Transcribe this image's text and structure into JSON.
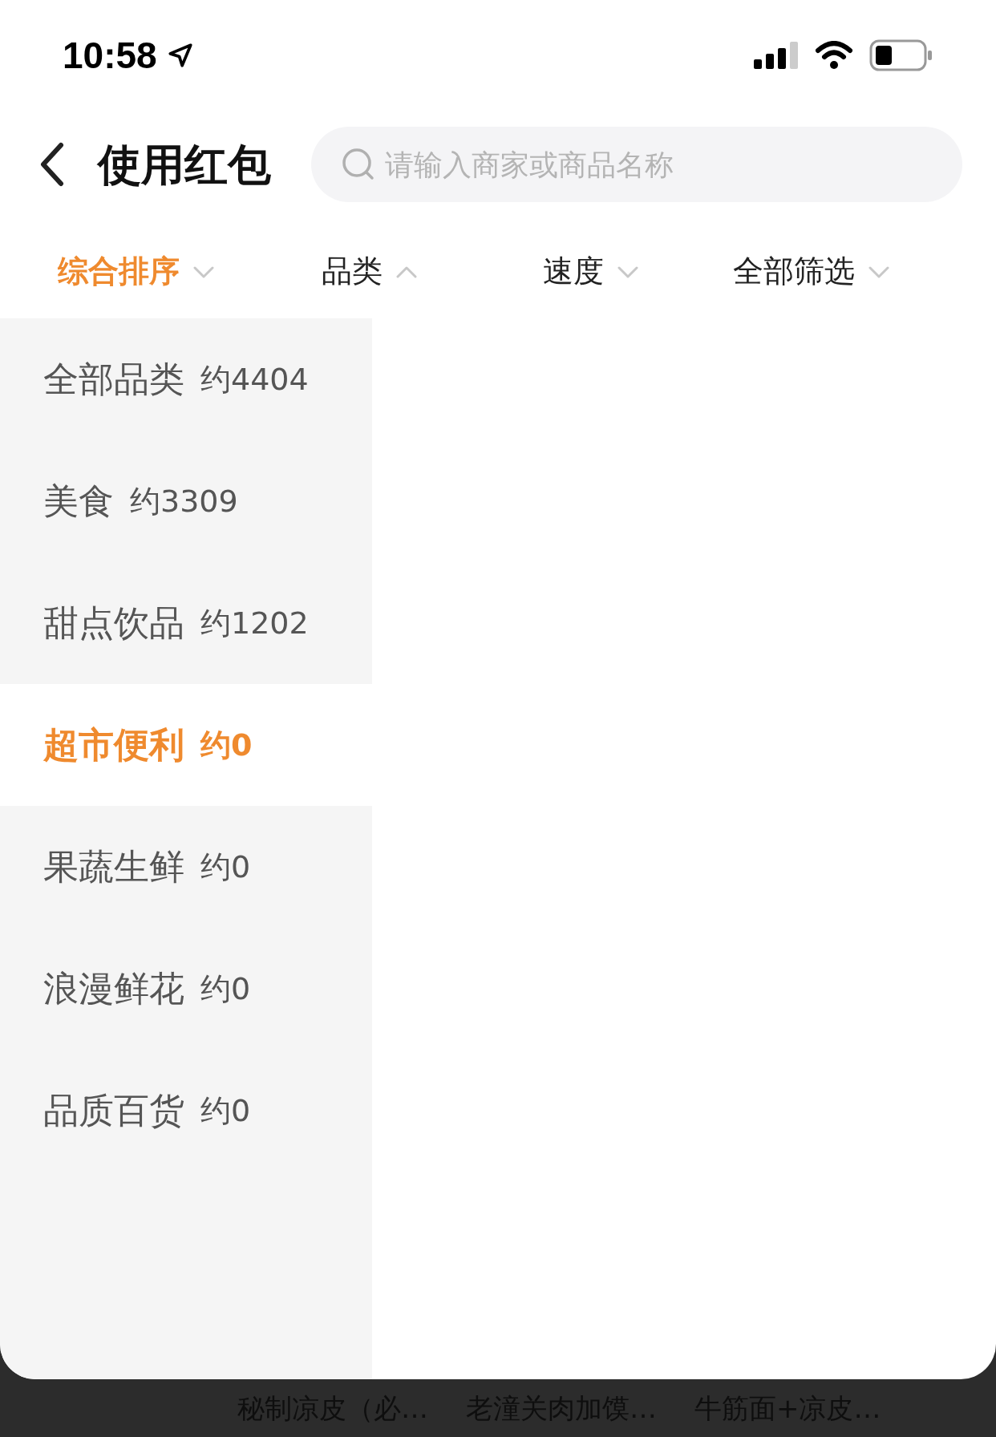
{
  "status_bar": {
    "time": "10:58"
  },
  "header": {
    "title": "使用红包",
    "search": {
      "placeholder": "请输入商家或商品名称"
    }
  },
  "filter_tabs": [
    {
      "label": "综合排序",
      "selected": true,
      "expanded": false
    },
    {
      "label": "品类",
      "selected": false,
      "expanded": true
    },
    {
      "label": "速度",
      "selected": false,
      "expanded": false
    },
    {
      "label": "全部筛选",
      "selected": false,
      "expanded": false
    }
  ],
  "categories": [
    {
      "name": "全部品类",
      "count": "约4404",
      "selected": false
    },
    {
      "name": "美食",
      "count": "约3309",
      "selected": false
    },
    {
      "name": "甜点饮品",
      "count": "约1202",
      "selected": false
    },
    {
      "name": "超市便利",
      "count": "约0",
      "selected": true
    },
    {
      "name": "果蔬生鲜",
      "count": "约0",
      "selected": false
    },
    {
      "name": "浪漫鲜花",
      "count": "约0",
      "selected": false
    },
    {
      "name": "品质百货",
      "count": "约0",
      "selected": false
    }
  ],
  "background_items": [
    {
      "name": "秘制凉皮（必…"
    },
    {
      "name": "老潼关肉加馍…"
    },
    {
      "name": "牛筋面+凉皮…"
    }
  ]
}
